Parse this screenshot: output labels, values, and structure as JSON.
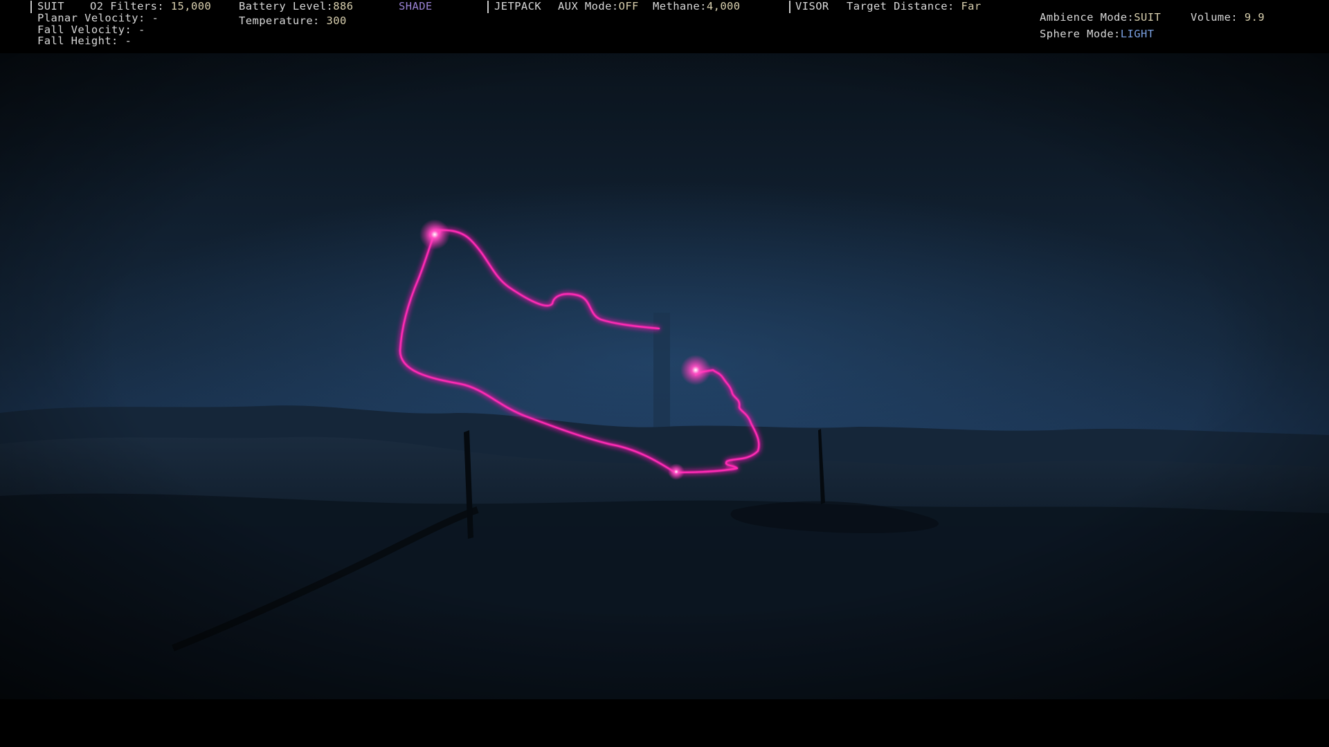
{
  "hud": {
    "suit": {
      "label": "SUIT",
      "o2_label": "O2 Filters:",
      "o2_value": "15,000",
      "planar_label": "Planar Velocity:",
      "planar_value": "-",
      "fall_velocity_label": "Fall Velocity:",
      "fall_velocity_value": "-",
      "fall_height_label": "Fall Height:",
      "fall_height_value": "-",
      "battery_label": "Battery Level:",
      "battery_value": "886",
      "temperature_label": "Temperature:",
      "temperature_value": "300",
      "shade_label": "SHADE"
    },
    "jetpack": {
      "label": "JETPACK",
      "aux_label": "AUX Mode:",
      "aux_value": "OFF",
      "methane_label": "Methane:",
      "methane_value": "4,000"
    },
    "visor": {
      "label": "VISOR",
      "target_label": "Target Distance:",
      "target_value": "Far"
    },
    "ambience": {
      "mode_label": "Ambience Mode:",
      "mode_value": "SUIT",
      "volume_label": "Volume:",
      "volume_value": "9.9",
      "sphere_label": "Sphere Mode:",
      "sphere_value": "LIGHT"
    }
  },
  "colors": {
    "laser": "#ff2bb4",
    "sky_top": "#0b1520",
    "sky_horizon": "#1f3b5e",
    "ground": "#0c1622"
  }
}
